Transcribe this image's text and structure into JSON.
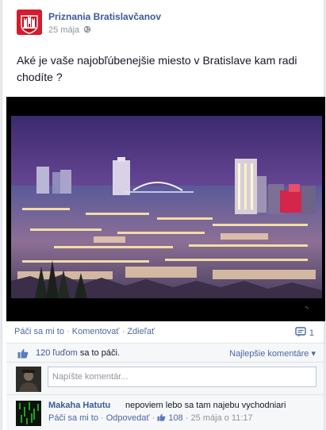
{
  "post": {
    "page_name": "Priznania Bratislavčanov",
    "date": "25 mája",
    "privacy_icon": "globe-icon",
    "text": "Aké je vaše najobľúbenejšie miesto v Bratislave kam radi chodíte ?",
    "photo_subject": "city-night-panorama"
  },
  "actions": {
    "like": "Páči sa mi to",
    "separator": " · ",
    "comment": "Komentovať",
    "share": "Zdieľať",
    "comment_count": "1"
  },
  "likes": {
    "count_link": "120 ľuďom",
    "suffix": " sa to páči.",
    "sort_label": "Najlepšie komentáre",
    "sort_arrow": "▾"
  },
  "composer": {
    "placeholder": "Napíšte komentár..."
  },
  "comment": {
    "author": "Makaha Hatutu",
    "text": "nepoviem lebo sa tam najebu vychodniari",
    "like": "Páči sa mi to",
    "reply": "Odpovedať",
    "like_count": "108",
    "time": "25 mája o 11:17",
    "separator": " · "
  },
  "colors": {
    "link_blue": "#3b5998",
    "brand_red": "#d61b2c",
    "background": "#e9ebee"
  }
}
